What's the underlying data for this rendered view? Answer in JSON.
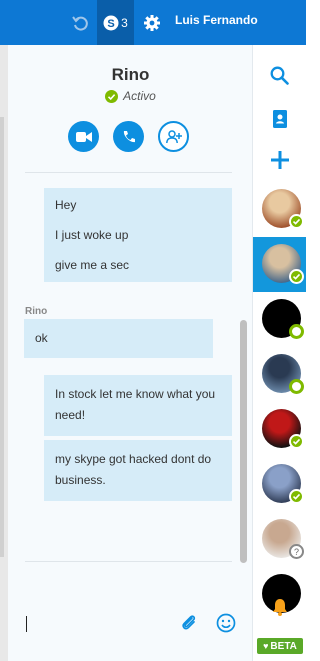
{
  "header": {
    "unread_count": "3",
    "user_name": "Luis Fernando"
  },
  "conversation": {
    "contact_name": "Rino",
    "status_text": "Activo",
    "messages": [
      {
        "from": "me",
        "lines": [
          "Hey",
          "I just woke up",
          "give me a sec"
        ]
      },
      {
        "from": "Rino",
        "sender_label": "Rino",
        "lines": [
          "ok"
        ]
      },
      {
        "from": "me",
        "text": "In stock let me know what you need!"
      },
      {
        "from": "me",
        "text": "my skype got hacked dont do business."
      }
    ]
  },
  "composer": {
    "value": "",
    "placeholder": ""
  },
  "rail": {
    "beta_label": "BETA",
    "contacts": [
      {
        "presence": "online",
        "colors": [
          "#a0522d",
          "#e8c9a0"
        ]
      },
      {
        "presence": "online",
        "colors": [
          "#4a6a8a",
          "#d8c0a0"
        ],
        "active": true
      },
      {
        "presence": "offline",
        "colors": [
          "#000000",
          "#000000"
        ]
      },
      {
        "presence": "offline",
        "colors": [
          "#6a88a8",
          "#2a3a52"
        ]
      },
      {
        "presence": "online",
        "colors": [
          "#111111",
          "#c01818"
        ]
      },
      {
        "presence": "online",
        "colors": [
          "#33405a",
          "#8aa0c8"
        ]
      },
      {
        "presence": "unknown",
        "colors": [
          "#e8e4e0",
          "#c8a890"
        ]
      },
      {
        "presence": "none",
        "colors": [
          "#000000",
          "#000000"
        ]
      }
    ]
  },
  "colors": {
    "brand_blue": "#0d78d4",
    "accent_blue": "#1397dc",
    "bubble": "#d6ecf8",
    "online_green": "#7fba00",
    "notification_orange": "#f7a11a"
  }
}
